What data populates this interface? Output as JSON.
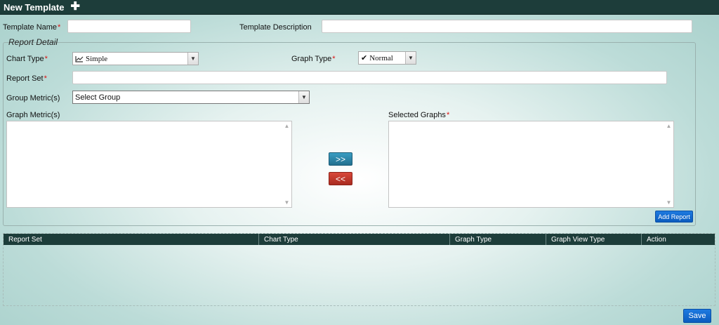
{
  "header": {
    "title": "New Template",
    "add_icon": "plus-icon"
  },
  "template_name": {
    "label": "Template Name",
    "required_mark": "*",
    "value": ""
  },
  "template_description": {
    "label": "Template Description",
    "value": ""
  },
  "report_detail": {
    "legend": "Report Detail",
    "chart_type": {
      "label": "Chart Type",
      "required_mark": "*",
      "selected": "Simple",
      "icon": "line-chart-icon"
    },
    "graph_type": {
      "label": "Graph Type",
      "required_mark": "*",
      "selected": "Normal",
      "icon": "checkmark-icon"
    },
    "report_set": {
      "label": "Report Set",
      "required_mark": "*",
      "value": ""
    },
    "group_metrics": {
      "label": "Group Metric(s)",
      "selected": "Select Group"
    },
    "graph_metrics": {
      "label": "Graph Metric(s)",
      "items": []
    },
    "selected_graphs": {
      "label": "Selected Graphs",
      "required_mark": "*",
      "items": []
    },
    "move_right_label": ">>",
    "move_left_label": "<<",
    "add_report_label": "Add Report"
  },
  "reports_table": {
    "columns": [
      "Report Set",
      "Chart Type",
      "Graph Type",
      "Graph View Type",
      "Action"
    ],
    "rows": []
  },
  "save_label": "Save",
  "colors": {
    "header_bg": "#1d3d3a",
    "move_right_btn": "#2e86a8",
    "move_left_btn": "#c23a2c",
    "primary_btn": "#0b5cbf",
    "required": "#dd1111"
  }
}
